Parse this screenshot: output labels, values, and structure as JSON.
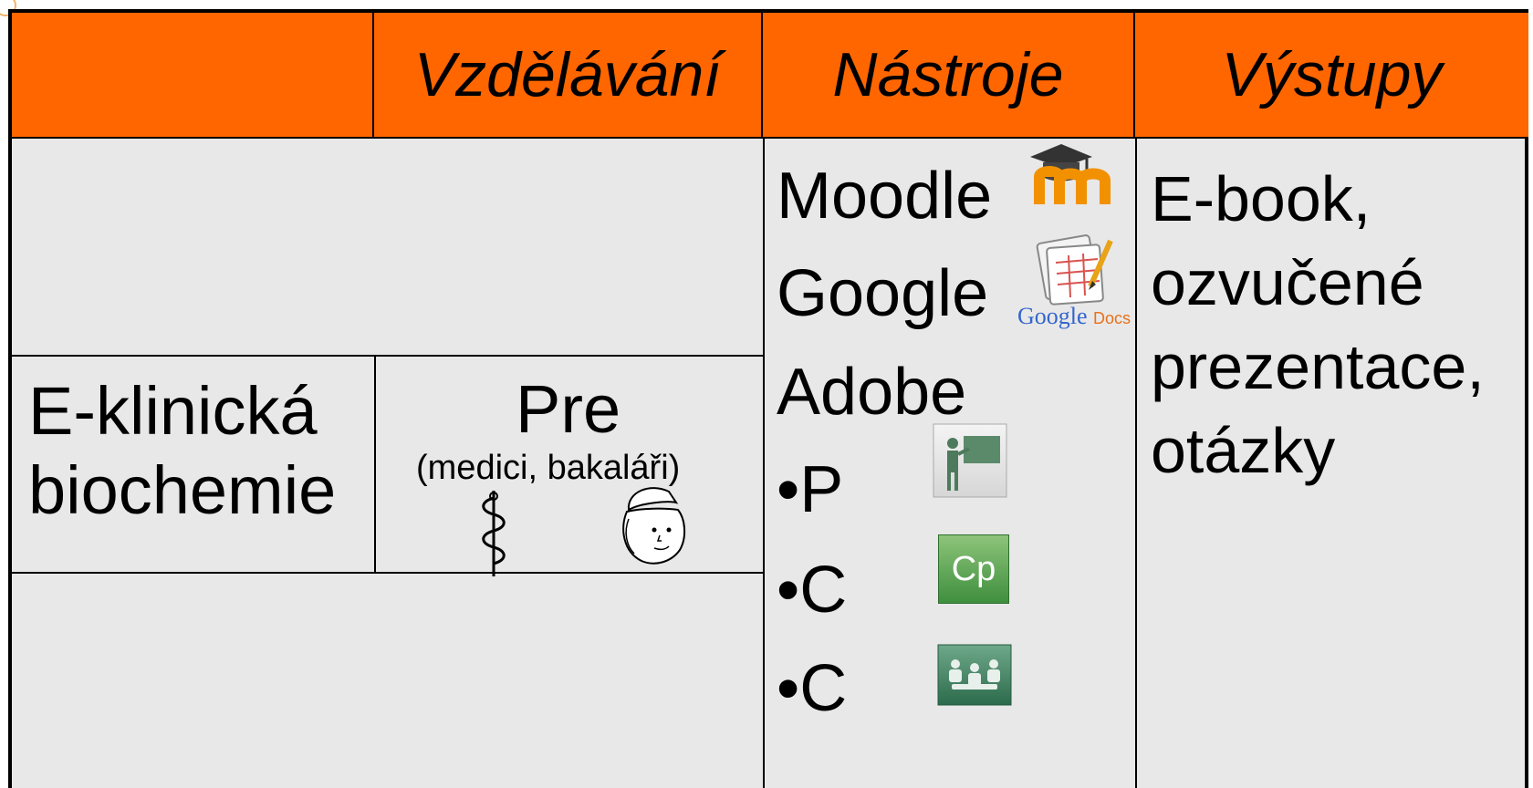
{
  "header": {
    "col1": "",
    "col2": "Vzdělávání",
    "col3": "Nástroje",
    "col4": "Výstupy"
  },
  "row": {
    "subject_line1": "E-klinická",
    "subject_line2": "biochemie",
    "stage": "Pre",
    "audience": "(medici, bakaláři)"
  },
  "tools": {
    "moodle": "Moodle",
    "google": "Google",
    "google_docs_logo_google": "Google",
    "google_docs_logo_docs": "Docs",
    "adobe": "Adobe",
    "item_p": "•P",
    "item_c1": "•C",
    "item_c2": "•C",
    "captivate_logo_text": "Cp"
  },
  "outputs": {
    "line1": "E-book,",
    "line2": "ozvučené",
    "line3": "prezentace,",
    "line4": "otázky"
  },
  "colors": {
    "header_bg": "#ff6600",
    "body_bg": "#e8e8e8",
    "border": "#000000"
  }
}
